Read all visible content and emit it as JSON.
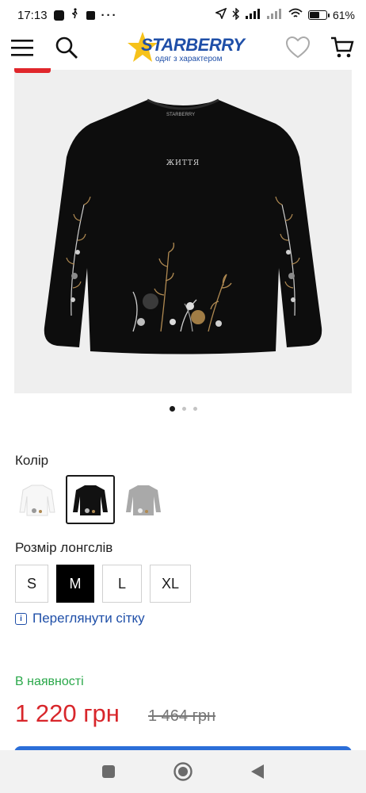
{
  "status_bar": {
    "time": "17:13",
    "battery_pct": "61",
    "battery_level": 0.61
  },
  "header": {
    "brand": "STARBERRY",
    "tagline": "одяг з характером",
    "icons": [
      "menu-icon",
      "search-icon",
      "heart-icon",
      "cart-icon"
    ]
  },
  "gallery": {
    "print_text": "ЖИТТЯ",
    "slides": 3,
    "active_slide": 1
  },
  "color": {
    "label": "Колір",
    "options": [
      {
        "name": "white",
        "hex": "#f5f5f5",
        "selected": false
      },
      {
        "name": "black",
        "hex": "#111111",
        "selected": true
      },
      {
        "name": "grey",
        "hex": "#a9a9a9",
        "selected": false
      }
    ]
  },
  "size": {
    "label": "Розмір лонгслів",
    "options": [
      "S",
      "M",
      "L",
      "XL"
    ],
    "selected": "M"
  },
  "size_grid_link": "Переглянути сітку",
  "availability": "В наявності",
  "price": {
    "current": "1 220 грн",
    "old": "1 464 грн"
  },
  "colors": {
    "brand_blue": "#1f4fa8",
    "price_red": "#d8262b",
    "stock_green": "#2aa84a",
    "star_yellow": "#f6c21a"
  }
}
